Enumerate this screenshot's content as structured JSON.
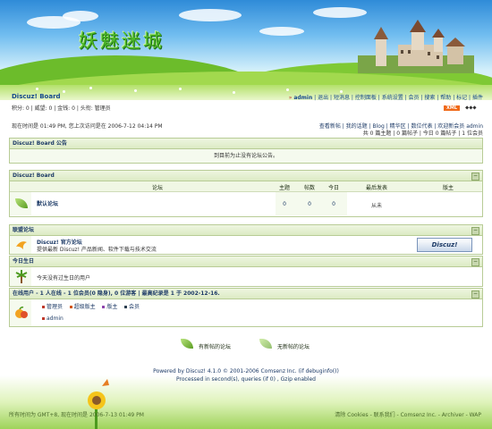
{
  "banner": {
    "logo_text": "妖魅迷城"
  },
  "header": {
    "board_title": "Discuz! Board",
    "nav_user": "admin",
    "nav_links": [
      "退出",
      "短消息",
      "控制面板",
      "系统设置",
      "会员",
      "搜索",
      "帮助",
      "标记",
      "插件"
    ],
    "xml_badge": "XML",
    "user_stats": "积分: 0 | 威望: 0 | 金钱: 0 | 头衔: 管理员"
  },
  "info": {
    "time_line": "现在时间是 01:49 PM, 您上次访问是在 2006-7-12 04:14 PM",
    "quick_links": "查看新帖 | 我的话题 | Blog | 精华区 | 数位代表 | 欢迎新会员 admin",
    "stats_line": "共 0 篇主题 | 0 篇帖子 | 今日 0 篇帖子 | 1 位会员"
  },
  "announce": {
    "title": "Discuz! Board 公告",
    "text": "到目前为止没有论坛公告。"
  },
  "forum": {
    "title": "Discuz! Board",
    "col_forum": "论坛",
    "col_topics": "主题",
    "col_posts": "帖数",
    "col_today": "今日",
    "col_last": "最后发表",
    "col_mod": "版主",
    "row": {
      "name": "默认论坛",
      "topics": "0",
      "posts": "0",
      "today": "0",
      "last": "从未",
      "mod": ""
    }
  },
  "links": {
    "title": "联盟论坛",
    "item_name": "Discuz! 官方论坛",
    "item_desc": "提供最新 Discuz! 产品新闻、软件下载与技术交流",
    "badge_text": "Discuz!"
  },
  "birthday": {
    "title": "今日生日",
    "text": "今天没有过生日的用户"
  },
  "online": {
    "title": "在线用户 - 1 人在线 - 1 位会员(0 隐身), 0 位游客 | 最高纪录是 1 于 2002-12-16.",
    "legend": [
      "管理员",
      "超级版主",
      "版主",
      "会员"
    ],
    "users": [
      "admin"
    ]
  },
  "legend_bottom": {
    "new_posts": "有新帖的论坛",
    "no_new_posts": "无新帖的论坛"
  },
  "footer": {
    "line1": "Powered by Discuz! 4.1.0 © 2001-2006 Comsenz Inc. (if debuginfo())",
    "line2": "Processed in second(s), queries (if 0) , Gzip enabled",
    "timezone": "所有时间为 GMT+8, 现在时间是 2006-7-13 01:49 PM",
    "right_links": "清除 Cookies - 联系我们 - Comsenz Inc. - Archiver - WAP"
  },
  "colors": {
    "accent": "#1c3a66",
    "box_border": "#b8cc96",
    "header_bg": "#dcebc4"
  }
}
